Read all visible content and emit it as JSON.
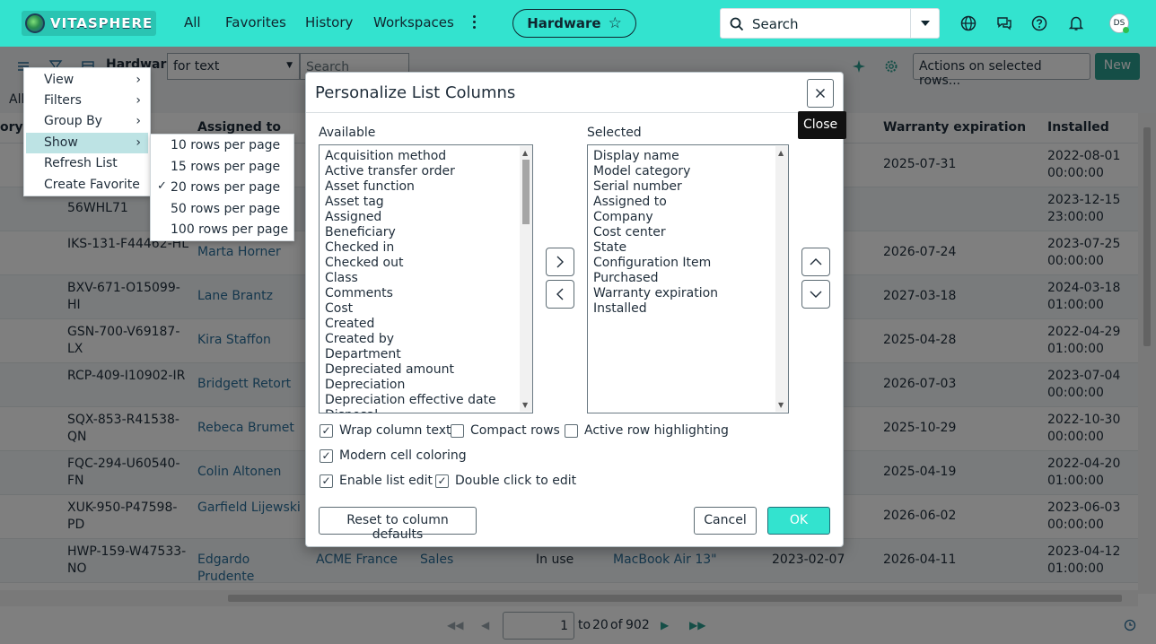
{
  "nav": {
    "brand": "VITASPHERE",
    "links": [
      "All",
      "Favorites",
      "History",
      "Workspaces"
    ],
    "pill_label": "Hardware",
    "search_placeholder": "Search",
    "avatar_initials": "DS",
    "icons": [
      "globe-icon",
      "chat-icon",
      "help-icon",
      "bell-icon"
    ]
  },
  "toolbar": {
    "title": "Hardware",
    "filter_select": "for text",
    "search_placeholder": "Search",
    "actions_select": "Actions on selected rows...",
    "new_label": "New"
  },
  "breadcrumb": "All",
  "table": {
    "headers": [
      "ory",
      "Assigned to",
      "Warranty expiration",
      "Installed"
    ],
    "rows": [
      {
        "tag": "",
        "assigned": "",
        "company": "",
        "dept": "",
        "state": "",
        "ci": "",
        "purchased": "",
        "warranty": "2025-07-31",
        "installed": "2022-08-01 00:00:00"
      },
      {
        "tag": "56WHL71",
        "assigned": "",
        "company": "",
        "dept": "",
        "state": "",
        "ci": "",
        "purchased": "",
        "warranty": "",
        "installed": "2023-12-15 23:00:00"
      },
      {
        "tag": "IKS-131-F44462-HL",
        "assigned": "Marta Horner",
        "company": "",
        "dept": "",
        "state": "",
        "ci": "",
        "purchased": "",
        "warranty": "2026-07-24",
        "installed": "2023-07-25 00:00:00"
      },
      {
        "tag": "BXV-671-O15099-HI",
        "assigned": "Lane Brantz",
        "company": "",
        "dept": "",
        "state": "",
        "ci": "",
        "purchased": "",
        "warranty": "2027-03-18",
        "installed": "2024-03-18 01:00:00"
      },
      {
        "tag": "GSN-700-V69187-LX",
        "assigned": "Kira Staffon",
        "company": "",
        "dept": "",
        "state": "",
        "ci": "",
        "purchased": "",
        "warranty": "2025-04-28",
        "installed": "2022-04-29 01:00:00"
      },
      {
        "tag": "RCP-409-I10902-IR",
        "assigned": "Bridgett Retort",
        "company": "",
        "dept": "",
        "state": "",
        "ci": "",
        "purchased": "",
        "warranty": "2026-07-03",
        "installed": "2023-07-04 00:00:00"
      },
      {
        "tag": "SQX-853-R41538-QN",
        "assigned": "Rebeca Brumet",
        "company": "",
        "dept": "",
        "state": "",
        "ci": "",
        "purchased": "",
        "warranty": "2025-10-29",
        "installed": "2022-10-30 00:00:00"
      },
      {
        "tag": "FQC-294-U60540-FN",
        "assigned": "Colin Altonen",
        "company": "",
        "dept": "",
        "state": "",
        "ci": "",
        "purchased": "",
        "warranty": "2025-04-19",
        "installed": "2022-04-20 01:00:00"
      },
      {
        "tag": "XUK-950-P47598-PD",
        "assigned": "Garfield Lijewski",
        "company": "",
        "dept": "",
        "state": "",
        "ci": "",
        "purchased": "",
        "warranty": "2026-06-02",
        "installed": "2023-06-03 00:00:00"
      },
      {
        "tag": "HWP-159-W47533-NO",
        "assigned": "Edgardo Prudente",
        "company": "ACME France",
        "dept": "Sales",
        "state": "In use",
        "ci": "MacBook Air 13\"",
        "purchased": "2023-02-07",
        "warranty": "2026-04-11",
        "installed": "2023-04-12 01:00:00"
      }
    ]
  },
  "pager": {
    "page": "1",
    "to_label": "to",
    "to_value": "20",
    "of_label": "of",
    "total": "902"
  },
  "context_menu": {
    "items": [
      {
        "label": "View",
        "submenu": true
      },
      {
        "label": "Filters",
        "submenu": true
      },
      {
        "label": "Group By",
        "submenu": true
      },
      {
        "label": "Show",
        "submenu": true,
        "active": true
      },
      {
        "label": "Refresh List",
        "submenu": false
      },
      {
        "label": "Create Favorite",
        "submenu": false
      }
    ],
    "show_submenu": [
      {
        "label": "10 rows per page",
        "checked": false
      },
      {
        "label": "15 rows per page",
        "checked": false
      },
      {
        "label": "20 rows per page",
        "checked": true
      },
      {
        "label": "50 rows per page",
        "checked": false
      },
      {
        "label": "100 rows per page",
        "checked": false
      }
    ]
  },
  "dialog": {
    "title": "Personalize List Columns",
    "close_tooltip": "Close",
    "available_label": "Available",
    "selected_label": "Selected",
    "available": [
      "Acquisition method",
      "Active transfer order",
      "Asset function",
      "Asset tag",
      "Assigned",
      "Beneficiary",
      "Checked in",
      "Checked out",
      "Class",
      "Comments",
      "Cost",
      "Created",
      "Created by",
      "Department",
      "Depreciated amount",
      "Depreciation",
      "Depreciation effective date",
      "Disposal"
    ],
    "selected": [
      "Display name",
      "Model category",
      "Serial number",
      "Assigned to",
      "Company",
      "Cost center",
      "State",
      "Configuration Item",
      "Purchased",
      "Warranty expiration",
      "Installed"
    ],
    "options": [
      {
        "label": "Wrap column text",
        "checked": true
      },
      {
        "label": "Compact rows",
        "checked": false
      },
      {
        "label": "Active row highlighting",
        "checked": false
      },
      {
        "label": "Modern cell coloring",
        "checked": true
      },
      {
        "label": "Enable list edit",
        "checked": true
      },
      {
        "label": "Double click to edit",
        "checked": true
      }
    ],
    "reset_label": "Reset to column defaults",
    "cancel_label": "Cancel",
    "ok_label": "OK"
  },
  "colors": {
    "brand": "#33e3cf",
    "link": "#2a6f9b",
    "new_button": "#2a9d8f"
  }
}
